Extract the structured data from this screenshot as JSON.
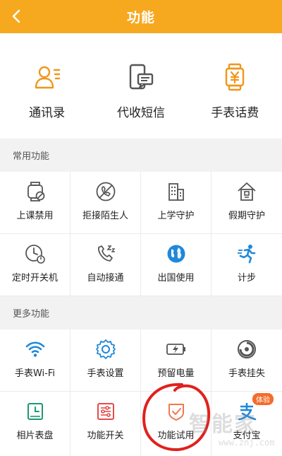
{
  "header": {
    "title": "功能"
  },
  "top_items": [
    {
      "label": "通讯录",
      "icon": "contacts-icon"
    },
    {
      "label": "代收短信",
      "icon": "message-phone-icon"
    },
    {
      "label": "手表话费",
      "icon": "watch-fee-icon"
    }
  ],
  "sections": {
    "common": {
      "title": "常用功能"
    },
    "more": {
      "title": "更多功能"
    }
  },
  "common_rows": [
    [
      {
        "label": "上课禁用",
        "icon": "watch-disable-icon"
      },
      {
        "label": "拒接陌生人",
        "icon": "reject-call-icon"
      },
      {
        "label": "上学守护",
        "icon": "school-building-icon"
      },
      {
        "label": "假期守护",
        "icon": "home-guard-icon"
      }
    ],
    [
      {
        "label": "定时开关机",
        "icon": "timer-power-icon"
      },
      {
        "label": "自动接通",
        "icon": "auto-answer-icon"
      },
      {
        "label": "出国使用",
        "icon": "globe-icon"
      },
      {
        "label": "计步",
        "icon": "step-runner-icon"
      }
    ]
  ],
  "more_rows": [
    [
      {
        "label": "手表Wi-Fi",
        "icon": "wifi-icon"
      },
      {
        "label": "手表设置",
        "icon": "settings-gear-icon"
      },
      {
        "label": "预留电量",
        "icon": "battery-icon"
      },
      {
        "label": "手表挂失",
        "icon": "report-loss-icon"
      }
    ],
    [
      {
        "label": "相片表盘",
        "icon": "photo-dial-icon"
      },
      {
        "label": "功能开关",
        "icon": "function-switch-icon"
      },
      {
        "label": "功能试用",
        "icon": "trial-shield-icon"
      },
      {
        "label": "支付宝",
        "icon": "alipay-icon",
        "badge": "体验"
      }
    ]
  ],
  "watermark": {
    "text": "智能家",
    "url": "www.znj.com"
  },
  "colors": {
    "header": "#F6A81E",
    "orange_icon": "#F0961B",
    "blue_icon": "#1F88D9",
    "green_icon": "#1E9A6E",
    "red_icon": "#E54B4B",
    "annotation": "#E0211D"
  }
}
